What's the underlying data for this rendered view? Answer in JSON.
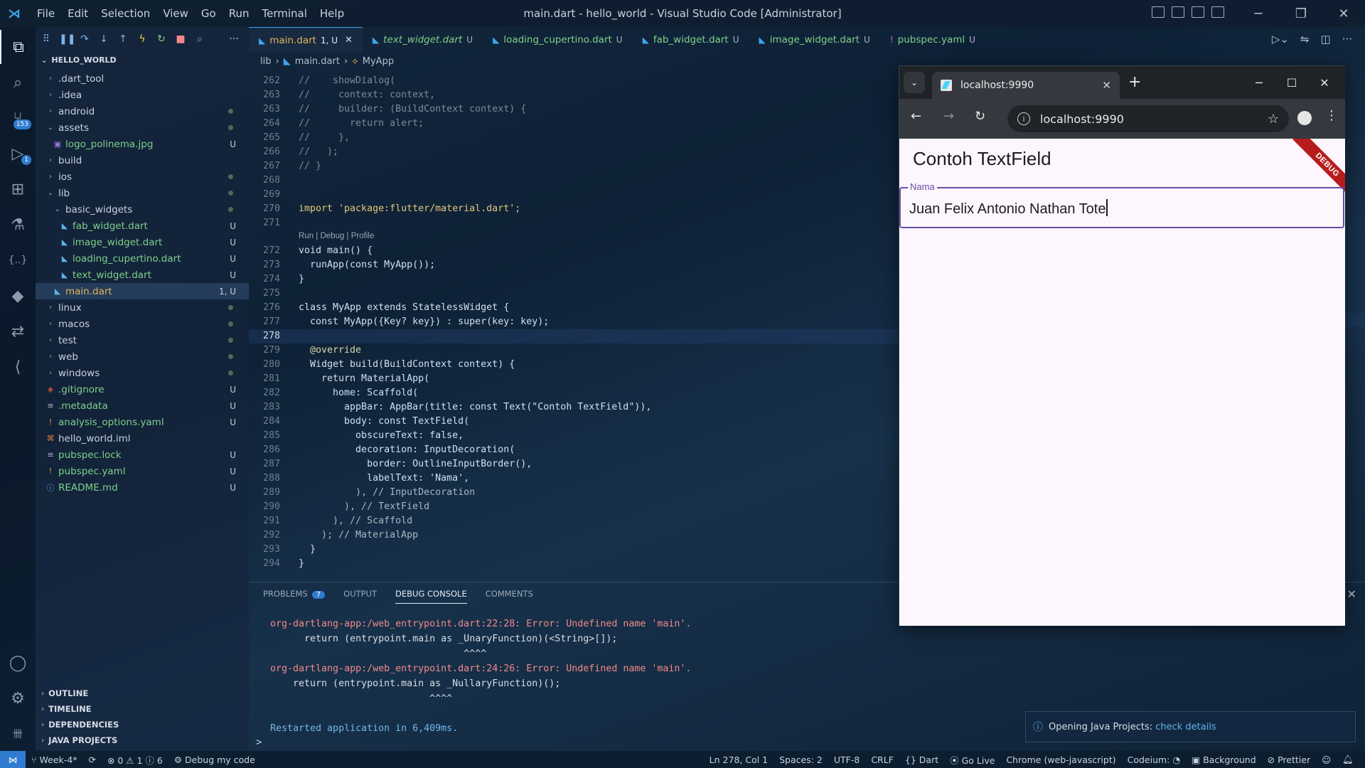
{
  "window": {
    "title": "main.dart - hello_world - Visual Studio Code [Administrator]",
    "menu": [
      "File",
      "Edit",
      "Selection",
      "View",
      "Go",
      "Run",
      "Terminal",
      "Help"
    ],
    "controls": {
      "minimize": "─",
      "restore": "❐",
      "close": "✕"
    }
  },
  "activity_bar": {
    "items": [
      {
        "name": "explorer-icon",
        "glyph": "⧉"
      },
      {
        "name": "search-icon",
        "glyph": "⌕"
      },
      {
        "name": "source-control-icon",
        "glyph": "⑂",
        "badge": "153"
      },
      {
        "name": "run-debug-icon",
        "glyph": "▷",
        "badge": "1"
      },
      {
        "name": "extensions-icon",
        "glyph": "⊞"
      },
      {
        "name": "testing-icon",
        "glyph": "⚗"
      },
      {
        "name": "json-icon",
        "glyph": "{..}"
      },
      {
        "name": "flutter-icon",
        "glyph": "◆"
      },
      {
        "name": "remote-icon",
        "glyph": "⇄"
      },
      {
        "name": "dart-icon",
        "glyph": "⟨"
      }
    ],
    "bottom": [
      {
        "name": "account-icon",
        "glyph": "◯"
      },
      {
        "name": "settings-gear-icon",
        "glyph": "⚙"
      },
      {
        "name": "copilot-icon",
        "glyph": "卌"
      }
    ]
  },
  "sidebar": {
    "root": "HELLO_WORLD",
    "tree": [
      {
        "label": ".dart_tool",
        "type": "folder",
        "open": false,
        "depth": 0,
        "status": ""
      },
      {
        "label": ".idea",
        "type": "folder",
        "open": false,
        "depth": 0,
        "status": ""
      },
      {
        "label": "android",
        "type": "folder",
        "open": false,
        "depth": 0,
        "status": "dot"
      },
      {
        "label": "assets",
        "type": "folder",
        "open": true,
        "depth": 0,
        "status": "dot"
      },
      {
        "label": "logo_polinema.jpg",
        "type": "image",
        "depth": 1,
        "status": "U"
      },
      {
        "label": "build",
        "type": "folder",
        "open": false,
        "depth": 0,
        "status": ""
      },
      {
        "label": "ios",
        "type": "folder",
        "open": false,
        "depth": 0,
        "status": "dot"
      },
      {
        "label": "lib",
        "type": "folder",
        "open": true,
        "depth": 0,
        "status": "dot"
      },
      {
        "label": "basic_widgets",
        "type": "folder",
        "open": true,
        "depth": 1,
        "status": "dot"
      },
      {
        "label": "fab_widget.dart",
        "type": "dart",
        "depth": 2,
        "status": "U"
      },
      {
        "label": "image_widget.dart",
        "type": "dart",
        "depth": 2,
        "status": "U"
      },
      {
        "label": "loading_cupertino.dart",
        "type": "dart",
        "depth": 2,
        "status": "U"
      },
      {
        "label": "text_widget.dart",
        "type": "dart",
        "depth": 2,
        "status": "U"
      },
      {
        "label": "main.dart",
        "type": "dart",
        "depth": 1,
        "status": "1, U",
        "selected": true
      },
      {
        "label": "linux",
        "type": "folder",
        "open": false,
        "depth": 0,
        "status": "dot"
      },
      {
        "label": "macos",
        "type": "folder",
        "open": false,
        "depth": 0,
        "status": "dot"
      },
      {
        "label": "test",
        "type": "folder",
        "open": false,
        "depth": 0,
        "status": "dot"
      },
      {
        "label": "web",
        "type": "folder",
        "open": false,
        "depth": 0,
        "status": "dot"
      },
      {
        "label": "windows",
        "type": "folder",
        "open": false,
        "depth": 0,
        "status": "dot"
      },
      {
        "label": ".gitignore",
        "type": "git",
        "depth": 0,
        "status": "U"
      },
      {
        "label": ".metadata",
        "type": "text",
        "depth": 0,
        "status": "U"
      },
      {
        "label": "analysis_options.yaml",
        "type": "yaml",
        "depth": 0,
        "status": "U"
      },
      {
        "label": "hello_world.iml",
        "type": "rss",
        "depth": 0,
        "status": ""
      },
      {
        "label": "pubspec.lock",
        "type": "text",
        "depth": 0,
        "status": "U"
      },
      {
        "label": "pubspec.yaml",
        "type": "yaml",
        "depth": 0,
        "status": "U"
      },
      {
        "label": "README.md",
        "type": "info",
        "depth": 0,
        "status": "U"
      }
    ],
    "sections": [
      "OUTLINE",
      "TIMELINE",
      "DEPENDENCIES",
      "JAVA PROJECTS"
    ]
  },
  "tabs": [
    {
      "label": "main.dart",
      "status": "1, U",
      "active": true,
      "italic": false
    },
    {
      "label": "text_widget.dart",
      "status": "U",
      "active": false,
      "italic": true
    },
    {
      "label": "loading_cupertino.dart",
      "status": "U",
      "active": false,
      "italic": false
    },
    {
      "label": "fab_widget.dart",
      "status": "U",
      "active": false,
      "italic": false
    },
    {
      "label": "image_widget.dart",
      "status": "U",
      "active": false,
      "italic": false
    },
    {
      "label": "pubspec.yaml",
      "status": "U",
      "active": false,
      "italic": false
    }
  ],
  "breadcrumb": [
    "lib",
    "main.dart",
    "MyApp"
  ],
  "codelens": "Run | Debug | Profile",
  "code": [
    {
      "n": "262",
      "t": "//    showDialog("
    },
    {
      "n": "263",
      "t": "//     context: context,"
    },
    {
      "n": "263",
      "t": "//     builder: (BuildContext context) {"
    },
    {
      "n": "264",
      "t": "//       return alert;"
    },
    {
      "n": "265",
      "t": "//     },"
    },
    {
      "n": "266",
      "t": "//   );"
    },
    {
      "n": "267",
      "t": "// }"
    },
    {
      "n": "268",
      "t": ""
    },
    {
      "n": "269",
      "t": ""
    },
    {
      "n": "270",
      "t": "import 'package:flutter/material.dart';"
    },
    {
      "n": "271",
      "t": ""
    },
    {
      "n": "272",
      "t": "void main() {"
    },
    {
      "n": "273",
      "t": "  runApp(const MyApp());"
    },
    {
      "n": "274",
      "t": "}"
    },
    {
      "n": "275",
      "t": ""
    },
    {
      "n": "276",
      "t": "class MyApp extends StatelessWidget {"
    },
    {
      "n": "277",
      "t": "  const MyApp({Key? key}) : super(key: key);"
    },
    {
      "n": "278",
      "t": "",
      "current": true
    },
    {
      "n": "279",
      "t": "  @override"
    },
    {
      "n": "280",
      "t": "  Widget build(BuildContext context) {"
    },
    {
      "n": "281",
      "t": "    return MaterialApp("
    },
    {
      "n": "282",
      "t": "      home: Scaffold("
    },
    {
      "n": "283",
      "t": "        appBar: AppBar(title: const Text(\"Contoh TextField\")),"
    },
    {
      "n": "284",
      "t": "        body: const TextField("
    },
    {
      "n": "285",
      "t": "          obscureText: false,"
    },
    {
      "n": "286",
      "t": "          decoration: InputDecoration("
    },
    {
      "n": "287",
      "t": "            border: OutlineInputBorder(),"
    },
    {
      "n": "288",
      "t": "            labelText: 'Nama',"
    },
    {
      "n": "289",
      "t": "          ), // InputDecoration"
    },
    {
      "n": "290",
      "t": "        ), // TextField"
    },
    {
      "n": "291",
      "t": "      ), // Scaffold"
    },
    {
      "n": "292",
      "t": "    ); // MaterialApp"
    },
    {
      "n": "293",
      "t": "  }"
    },
    {
      "n": "294",
      "t": "}"
    }
  ],
  "panel": {
    "tabs": [
      "PROBLEMS",
      "OUTPUT",
      "DEBUG CONSOLE",
      "COMMENTS"
    ],
    "problems_count": "7",
    "active_tab": "DEBUG CONSOLE",
    "console": [
      {
        "text": "org-dartlang-app:/web_entrypoint.dart:22:28: Error: Undefined name 'main'.",
        "kind": "err"
      },
      {
        "text": "      return (entrypoint.main as _UnaryFunction)(<String>[]);",
        "kind": "plain"
      },
      {
        "text": "                                  ^^^^",
        "kind": "plain"
      },
      {
        "text": "org-dartlang-app:/web_entrypoint.dart:24:26: Error: Undefined name 'main'.",
        "kind": "err"
      },
      {
        "text": "    return (entrypoint.main as _NullaryFunction)();",
        "kind": "plain"
      },
      {
        "text": "                            ^^^^",
        "kind": "plain"
      },
      {
        "text": "",
        "kind": "plain"
      },
      {
        "text": "Restarted application in 6,409ms.",
        "kind": "info"
      }
    ],
    "prompt": ">"
  },
  "notification": {
    "text": "Opening Java Projects:",
    "link": "check details"
  },
  "status_bar": {
    "branch": "Week-4*",
    "problems": "⊗ 0 ⚠ 1 ⓘ 6",
    "debug": "Debug my code",
    "position": "Ln 278, Col 1",
    "spaces": "Spaces: 2",
    "encoding": "UTF-8",
    "eol": "CRLF",
    "language": "{} Dart",
    "golive": "Go Live",
    "device": "Chrome (web-javascript)",
    "codeium": "Codeium:",
    "background": "Background",
    "prettier": "Prettier"
  },
  "browser": {
    "tab_title": "localhost:9990",
    "url": "localhost:9990",
    "app": {
      "appbar_title": "Contoh TextField",
      "debug_banner": "DEBUG",
      "field_label": "Nama",
      "field_value": "Juan Felix Antonio Nathan Tote"
    }
  },
  "colors": {
    "accent": "#3ea7ee",
    "error": "#f28a8a",
    "info": "#6fb7ee",
    "field_border": "#6a4ea8",
    "debug_banner": "#b71c1c"
  }
}
